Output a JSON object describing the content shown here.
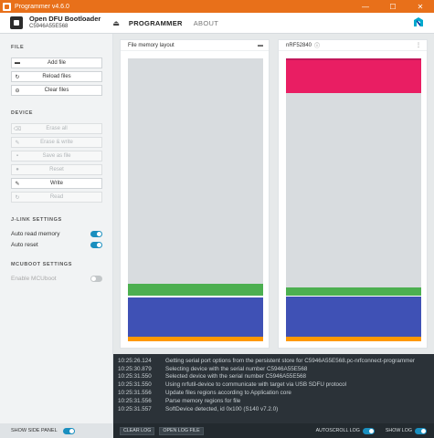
{
  "window": {
    "title": "Programmer v4.6.0",
    "buttons": [
      "—",
      "☐",
      "✕"
    ]
  },
  "device": {
    "name": "Open DFU Bootloader",
    "serial": "C5946A55E568",
    "icon": "device-chip-icon"
  },
  "nav": {
    "tabs": [
      "PROGRAMMER",
      "ABOUT"
    ],
    "active": "PROGRAMMER"
  },
  "sidebar": {
    "file_title": "FILE",
    "file_buttons": [
      "Add file",
      "Reload files",
      "Clear files"
    ],
    "device_title": "DEVICE",
    "device_buttons": [
      "Erase all",
      "Erase & write",
      "Save as file",
      "Reset",
      "Write",
      "Read"
    ],
    "jlink_title": "J-LINK SETTINGS",
    "auto_read_memory": "Auto read memory",
    "auto_reset": "Auto reset",
    "mcuboot_title": "MCUBOOT SETTINGS",
    "enable_mcuboot": "Enable MCUboot",
    "toggles": {
      "auto_read_memory": true,
      "auto_reset": true,
      "enable_mcuboot": false
    }
  },
  "file_memory": {
    "title": "File memory layout",
    "regions": [
      {
        "color": "#d8dcdf",
        "label": "empty"
      },
      {
        "color": "#4caf50",
        "label": "region"
      },
      {
        "color": "#3f51b5",
        "label": "region"
      },
      {
        "color": "#ff9800",
        "label": "region"
      }
    ]
  },
  "device_memory": {
    "title": "nRF52840",
    "regions": [
      {
        "color": "#e91e63",
        "label": "region"
      },
      {
        "color": "#d8dcdf",
        "label": "empty"
      },
      {
        "color": "#4caf50",
        "label": "region"
      },
      {
        "color": "#3f51b5",
        "label": "region"
      },
      {
        "color": "#ff9800",
        "label": "region"
      }
    ]
  },
  "log": [
    {
      "time": "10:25:26.124",
      "msg": "Getting serial port options from the persistent store for C5946A55E568.pc-nrfconnect-programmer"
    },
    {
      "time": "10:25:30.879",
      "msg": "Selecting device with the serial number C5946A55E568"
    },
    {
      "time": "10:25:31.550",
      "msg": "Selected device with the serial number C5946A55E568"
    },
    {
      "time": "10:25:31.550",
      "msg": "Using nrfutil-device to communicate with target via USB SDFU protocol"
    },
    {
      "time": "10:25:31.556",
      "msg": "Update files regions according to Application core"
    },
    {
      "time": "10:25:31.556",
      "msg": "Parse memory regions for file"
    },
    {
      "time": "10:25:31.557",
      "msg": "SoftDevice detected, id 0x100 (S140 v7.2.0)"
    }
  ],
  "footer": {
    "show_side_panel": "SHOW SIDE PANEL",
    "clear_log": "CLEAR LOG",
    "open_log_file": "OPEN LOG FILE",
    "autoscroll_log": "AUTOSCROLL LOG",
    "show_log": "SHOW LOG"
  },
  "colors": {
    "titlebar": "#e8701a",
    "accent": "#1a8fbf",
    "log_bg": "#2b3238"
  }
}
